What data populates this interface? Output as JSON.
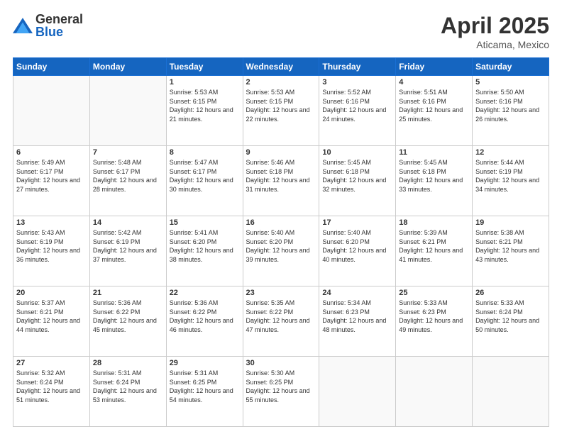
{
  "header": {
    "logo_general": "General",
    "logo_blue": "Blue",
    "month_title": "April 2025",
    "location": "Aticama, Mexico"
  },
  "days_of_week": [
    "Sunday",
    "Monday",
    "Tuesday",
    "Wednesday",
    "Thursday",
    "Friday",
    "Saturday"
  ],
  "weeks": [
    [
      {
        "day": "",
        "info": ""
      },
      {
        "day": "",
        "info": ""
      },
      {
        "day": "1",
        "info": "Sunrise: 5:53 AM\nSunset: 6:15 PM\nDaylight: 12 hours and 21 minutes."
      },
      {
        "day": "2",
        "info": "Sunrise: 5:53 AM\nSunset: 6:15 PM\nDaylight: 12 hours and 22 minutes."
      },
      {
        "day": "3",
        "info": "Sunrise: 5:52 AM\nSunset: 6:16 PM\nDaylight: 12 hours and 24 minutes."
      },
      {
        "day": "4",
        "info": "Sunrise: 5:51 AM\nSunset: 6:16 PM\nDaylight: 12 hours and 25 minutes."
      },
      {
        "day": "5",
        "info": "Sunrise: 5:50 AM\nSunset: 6:16 PM\nDaylight: 12 hours and 26 minutes."
      }
    ],
    [
      {
        "day": "6",
        "info": "Sunrise: 5:49 AM\nSunset: 6:17 PM\nDaylight: 12 hours and 27 minutes."
      },
      {
        "day": "7",
        "info": "Sunrise: 5:48 AM\nSunset: 6:17 PM\nDaylight: 12 hours and 28 minutes."
      },
      {
        "day": "8",
        "info": "Sunrise: 5:47 AM\nSunset: 6:17 PM\nDaylight: 12 hours and 30 minutes."
      },
      {
        "day": "9",
        "info": "Sunrise: 5:46 AM\nSunset: 6:18 PM\nDaylight: 12 hours and 31 minutes."
      },
      {
        "day": "10",
        "info": "Sunrise: 5:45 AM\nSunset: 6:18 PM\nDaylight: 12 hours and 32 minutes."
      },
      {
        "day": "11",
        "info": "Sunrise: 5:45 AM\nSunset: 6:18 PM\nDaylight: 12 hours and 33 minutes."
      },
      {
        "day": "12",
        "info": "Sunrise: 5:44 AM\nSunset: 6:19 PM\nDaylight: 12 hours and 34 minutes."
      }
    ],
    [
      {
        "day": "13",
        "info": "Sunrise: 5:43 AM\nSunset: 6:19 PM\nDaylight: 12 hours and 36 minutes."
      },
      {
        "day": "14",
        "info": "Sunrise: 5:42 AM\nSunset: 6:19 PM\nDaylight: 12 hours and 37 minutes."
      },
      {
        "day": "15",
        "info": "Sunrise: 5:41 AM\nSunset: 6:20 PM\nDaylight: 12 hours and 38 minutes."
      },
      {
        "day": "16",
        "info": "Sunrise: 5:40 AM\nSunset: 6:20 PM\nDaylight: 12 hours and 39 minutes."
      },
      {
        "day": "17",
        "info": "Sunrise: 5:40 AM\nSunset: 6:20 PM\nDaylight: 12 hours and 40 minutes."
      },
      {
        "day": "18",
        "info": "Sunrise: 5:39 AM\nSunset: 6:21 PM\nDaylight: 12 hours and 41 minutes."
      },
      {
        "day": "19",
        "info": "Sunrise: 5:38 AM\nSunset: 6:21 PM\nDaylight: 12 hours and 43 minutes."
      }
    ],
    [
      {
        "day": "20",
        "info": "Sunrise: 5:37 AM\nSunset: 6:21 PM\nDaylight: 12 hours and 44 minutes."
      },
      {
        "day": "21",
        "info": "Sunrise: 5:36 AM\nSunset: 6:22 PM\nDaylight: 12 hours and 45 minutes."
      },
      {
        "day": "22",
        "info": "Sunrise: 5:36 AM\nSunset: 6:22 PM\nDaylight: 12 hours and 46 minutes."
      },
      {
        "day": "23",
        "info": "Sunrise: 5:35 AM\nSunset: 6:22 PM\nDaylight: 12 hours and 47 minutes."
      },
      {
        "day": "24",
        "info": "Sunrise: 5:34 AM\nSunset: 6:23 PM\nDaylight: 12 hours and 48 minutes."
      },
      {
        "day": "25",
        "info": "Sunrise: 5:33 AM\nSunset: 6:23 PM\nDaylight: 12 hours and 49 minutes."
      },
      {
        "day": "26",
        "info": "Sunrise: 5:33 AM\nSunset: 6:24 PM\nDaylight: 12 hours and 50 minutes."
      }
    ],
    [
      {
        "day": "27",
        "info": "Sunrise: 5:32 AM\nSunset: 6:24 PM\nDaylight: 12 hours and 51 minutes."
      },
      {
        "day": "28",
        "info": "Sunrise: 5:31 AM\nSunset: 6:24 PM\nDaylight: 12 hours and 53 minutes."
      },
      {
        "day": "29",
        "info": "Sunrise: 5:31 AM\nSunset: 6:25 PM\nDaylight: 12 hours and 54 minutes."
      },
      {
        "day": "30",
        "info": "Sunrise: 5:30 AM\nSunset: 6:25 PM\nDaylight: 12 hours and 55 minutes."
      },
      {
        "day": "",
        "info": ""
      },
      {
        "day": "",
        "info": ""
      },
      {
        "day": "",
        "info": ""
      }
    ]
  ]
}
